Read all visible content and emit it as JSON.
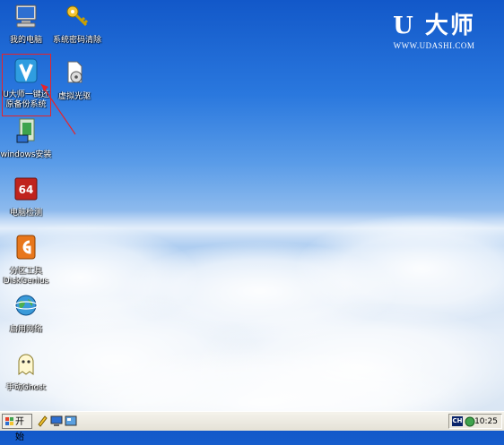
{
  "brand": {
    "logo": "U 大师",
    "url": "WWW.UDASHI.COM"
  },
  "icons": {
    "my_computer": "我的电脑",
    "password_clear": "系统密码清除",
    "udashi_backup": "U大师一键还\n原备份系统",
    "virtual_drive": "虚拟光驱",
    "windows_install": "windows安装",
    "cpu_test": "电脑检测",
    "partition_tool": "分区工具\nDiskGenius",
    "network": "启用网络",
    "manual_ghost": "手动Ghost"
  },
  "taskbar": {
    "start_label": "开始",
    "ime": "CH",
    "clock": "10:25"
  },
  "colors": {
    "sky_top": "#1258c9",
    "selection_box": "#e8232a",
    "taskbar": "#ece9df"
  }
}
